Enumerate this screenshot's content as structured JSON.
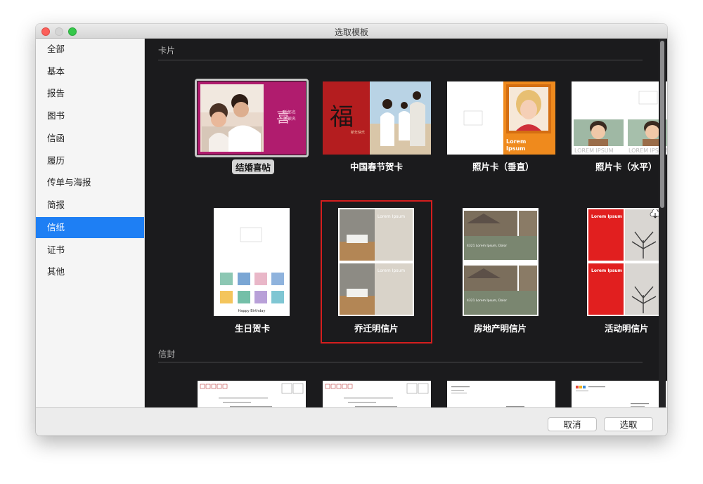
{
  "window": {
    "title": "选取模板"
  },
  "sidebar": {
    "items": [
      {
        "label": "全部"
      },
      {
        "label": "基本"
      },
      {
        "label": "报告"
      },
      {
        "label": "图书"
      },
      {
        "label": "信函"
      },
      {
        "label": "履历"
      },
      {
        "label": "传单与海报"
      },
      {
        "label": "简报"
      },
      {
        "label": "信纸",
        "selected": true
      },
      {
        "label": "证书"
      },
      {
        "label": "其他"
      }
    ]
  },
  "sections": {
    "cards": {
      "title": "卡片"
    },
    "envelopes": {
      "title": "信封"
    }
  },
  "templates": {
    "wedding": {
      "label": "结婚喜帖",
      "text1": "喜",
      "text2": "新郎名",
      "text3": "新娘名"
    },
    "spring": {
      "label": "中国春节贺卡",
      "text1": "福",
      "text2": "新年快乐"
    },
    "photo_v": {
      "label": "照片卡（垂直）",
      "text1": "Lorem",
      "text2": "Ipsum"
    },
    "photo_h": {
      "label": "照片卡（水平）",
      "text1": "LOREM IPSUM",
      "text2": "LOREM IPSUM"
    },
    "birthday": {
      "label": "生日贺卡",
      "text1": "Happy Birthday"
    },
    "moving": {
      "label": "乔迁明信片",
      "text1": "Lorem Ipsum",
      "text2": "Lorem Ipsum"
    },
    "realestate": {
      "label": "房地产明信片",
      "text1": "4321 Lorem Ipsum, Dolor",
      "text2": "4321 Lorem Ipsum, Dolor"
    },
    "event": {
      "label": "活动明信片",
      "text1": "Lorem Ipsum",
      "text2": "Lorem Ipsum"
    }
  },
  "buttons": {
    "cancel": "取消",
    "choose": "选取"
  },
  "colors": {
    "accent": "#1e7ff4",
    "highlight_box": "#d51e1e",
    "content_bg": "#1b1b1d"
  }
}
